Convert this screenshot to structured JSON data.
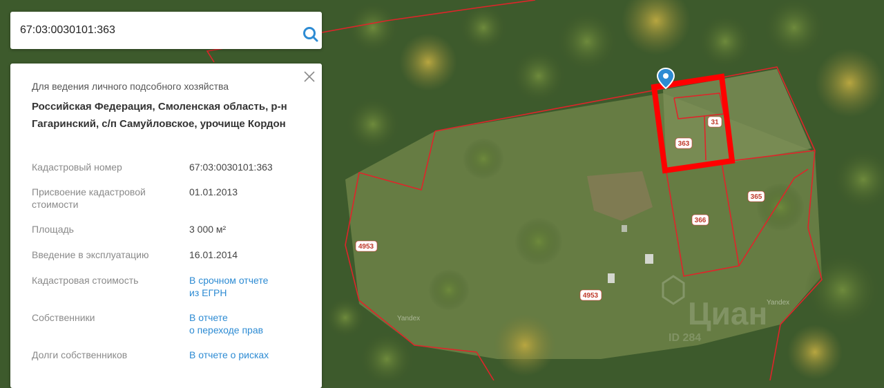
{
  "search": {
    "value": "67:03:0030101:363"
  },
  "panel": {
    "purpose": "Для ведения личного подсобного хозяйства",
    "address": "Российская Федерация, Смоленская область, р-н Гагаринский, с/п Самуйловское, урочище Кордон",
    "rows": [
      {
        "label": "Кадастровый номер",
        "value": "67:03:0030101:363"
      },
      {
        "label": "Присвоение кадастровой стоимости",
        "value": "01.01.2013"
      },
      {
        "label": "Площадь",
        "value": "3 000 м²"
      },
      {
        "label": "Введение в эксплуатацию",
        "value": "16.01.2014"
      },
      {
        "label": "Кадастровая стоимость",
        "value_line1": "В срочном отчете",
        "value_line2": "из ЕГРН"
      },
      {
        "label": "Собственники",
        "value_line1": "В отчете",
        "value_line2": "о переходе прав"
      },
      {
        "label": "Долги собственников",
        "value": "В отчете о рисках"
      }
    ]
  },
  "map": {
    "parcel_labels": [
      "363",
      "31",
      "365",
      "366",
      "4953",
      "4953"
    ],
    "provider_label": "Yandex",
    "watermark": "Циан",
    "watermark_id": "ID 284"
  },
  "colors": {
    "parcel_line": "#e0242a",
    "link": "#2d8bd3",
    "highlight": "#ff0000",
    "marker": "#2d8bd3"
  },
  "icons": {
    "search": "search-icon",
    "close": "close-icon",
    "marker": "map-pin-icon"
  }
}
